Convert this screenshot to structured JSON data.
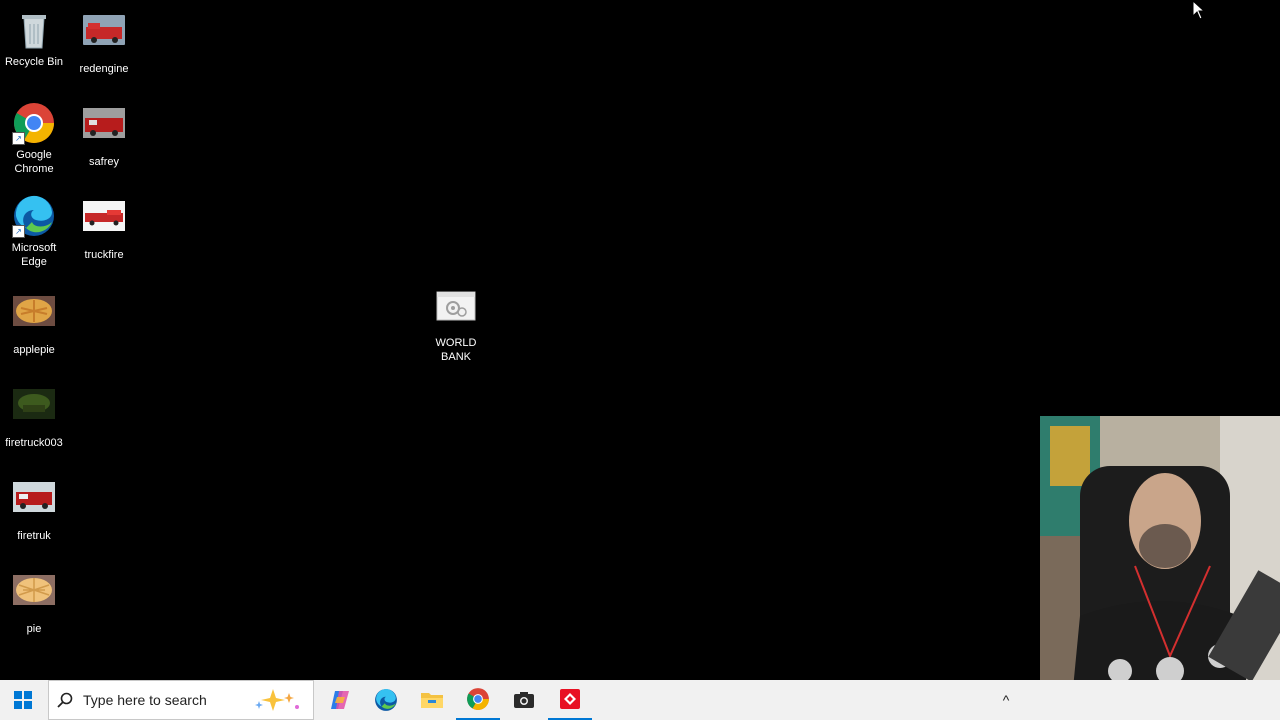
{
  "desktop": {
    "icons": [
      {
        "label": "Recycle Bin",
        "icon": "recycle-bin-icon"
      },
      {
        "label": "redengine",
        "icon": "image-thumbnail"
      },
      {
        "label": "Google Chrome",
        "icon": "chrome-icon"
      },
      {
        "label": "safrey",
        "icon": "image-thumbnail"
      },
      {
        "label": "Microsoft Edge",
        "icon": "edge-icon"
      },
      {
        "label": "truckfire",
        "icon": "image-thumbnail"
      },
      {
        "label": "applepie",
        "icon": "image-thumbnail"
      },
      {
        "label": "firetruck003",
        "icon": "image-thumbnail"
      },
      {
        "label": "firetruk",
        "icon": "image-thumbnail"
      },
      {
        "label": "pie",
        "icon": "image-thumbnail"
      },
      {
        "label": "WORLD BANK",
        "icon": "settings-file-icon"
      }
    ]
  },
  "taskbar": {
    "search_placeholder": "Type here to search",
    "apps": [
      "copilot-icon",
      "edge-icon",
      "file-explorer-icon",
      "chrome-icon",
      "camera-icon",
      "recorder-icon"
    ],
    "tray_chevron": "^"
  },
  "colors": {
    "desktop_bg": "#000000",
    "taskbar_bg": "#f1f1f1",
    "accent": "#0078d4"
  }
}
